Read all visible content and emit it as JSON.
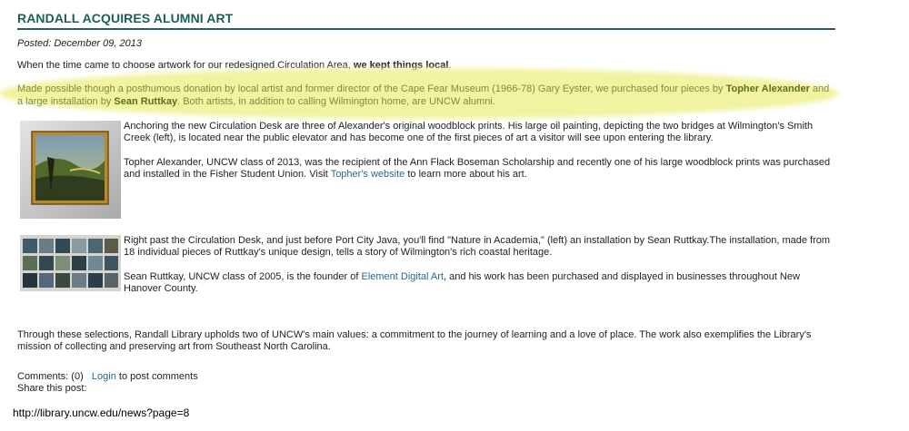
{
  "post": {
    "title": "RANDALL ACQUIRES ALUMNI ART",
    "posted": "Posted: December 09, 2013",
    "intro_text": "When the time came to choose artwork for our redesigned Circulation Area, ",
    "intro_bold": "we kept things local",
    "intro_end": ".",
    "highlight": {
      "part1": "Made possible though a posthumous donation by local artist and former director of the Cape Fear Museum (1966-78) Gary Eyster, we purchased four pieces by ",
      "name1": "Topher Alexander",
      "part2": " and a large installation by ",
      "name2": "Sean Ruttkay",
      "part3": ". Both artists, in addition to calling Wilmington home, are UNCW alumni."
    },
    "alexander": {
      "para1": "Anchoring the new Circulation Desk are three of Alexander's original woodblock prints. His large oil painting, depicting the two bridges at Wilmington's Smith Creek (left), is located near the public elevator and has become one of the first pieces of art a visitor will see upon entering the library.",
      "para2_a": "Topher Alexander, UNCW class of 2013, was the recipient of the Ann Flack Boseman Scholarship and recently one of his large woodblock prints was purchased and installed in the Fisher Student Union. Visit ",
      "para2_link": "Topher's website",
      "para2_b": " to learn more about his art."
    },
    "ruttkay": {
      "para1": "Right past the Circulation Desk, and just before Port City Java, you'll find \"Nature in Academia,\" (left) an installation by Sean Ruttkay.The installation, made from 18 individual pieces of Ruttkay's unique design, tells a story of Wilmington's rich coastal heritage.",
      "para2_a": "Sean Ruttkay, UNCW class of 2005, is the founder of ",
      "para2_link": "Element Digital Art",
      "para2_b": ", and his work has been purchased and displayed in businesses throughout New Hanover County."
    },
    "closing": "Through these selections, Randall Library upholds two of UNCW's main values: a commitment to the journey of learning and a love of place. The work also exemplifies the Library's mission of collecting and preserving art from Southeast North Carolina."
  },
  "meta": {
    "comments": "Comments: (0)",
    "login": "Login",
    "login_suffix": " to post comments",
    "share": "Share this post:"
  },
  "url": "http://library.uncw.edu/news?page=8",
  "colors": {
    "title": "#1c5f5a",
    "link": "#2a6a8a",
    "highlight": "#f1f3a0"
  }
}
